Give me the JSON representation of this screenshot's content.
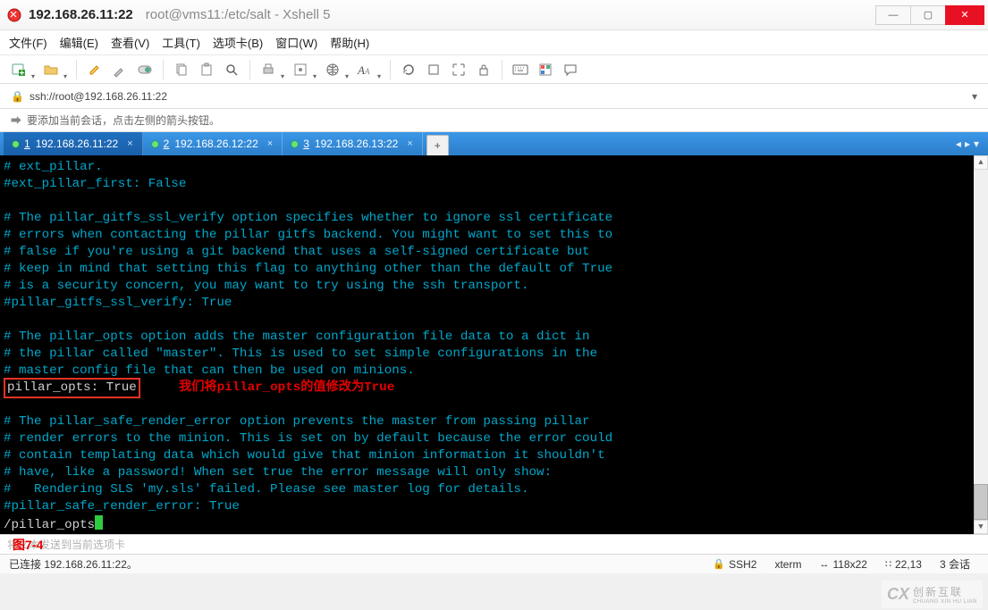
{
  "window": {
    "address_label": "192.168.26.11:22",
    "path_label": "root@vms11:/etc/salt - Xshell 5"
  },
  "menu": {
    "items": [
      "文件(F)",
      "编辑(E)",
      "查看(V)",
      "工具(T)",
      "选项卡(B)",
      "窗口(W)",
      "帮助(H)"
    ]
  },
  "toolbar": {
    "icons": [
      "new-session-icon",
      "open-folder-icon",
      "highlight-icon",
      "eyedropper-icon",
      "toggle-icon",
      "copy-icon",
      "paste-icon",
      "search-icon",
      "print-icon",
      "target-icon",
      "globe-icon",
      "font-icon",
      "refresh-icon",
      "maximize-icon",
      "expand-icon",
      "lock-icon",
      "keyboard-icon",
      "palette-icon",
      "chat-icon"
    ]
  },
  "address": {
    "url": "ssh://root@192.168.26.11:22"
  },
  "hint": {
    "text": "要添加当前会话，点击左侧的箭头按钮。"
  },
  "tabs": {
    "items": [
      {
        "num": "1",
        "label": "192.168.26.11:22",
        "active": true
      },
      {
        "num": "2",
        "label": "192.168.26.12:22",
        "active": false
      },
      {
        "num": "3",
        "label": "192.168.26.13:22",
        "active": false
      }
    ],
    "add": "+"
  },
  "terminal": {
    "lines": [
      "# ext_pillar.",
      "#ext_pillar_first: False",
      "",
      "# The pillar_gitfs_ssl_verify option specifies whether to ignore ssl certificate",
      "# errors when contacting the pillar gitfs backend. You might want to set this to",
      "# false if you're using a git backend that uses a self-signed certificate but",
      "# keep in mind that setting this flag to anything other than the default of True",
      "# is a security concern, you may want to try using the ssh transport.",
      "#pillar_gitfs_ssl_verify: True",
      "",
      "# The pillar_opts option adds the master configuration file data to a dict in",
      "# the pillar called \"master\". This is used to set simple configurations in the",
      "# master config file that can then be used on minions."
    ],
    "highlight": "pillar_opts: True",
    "annotation": "我们将pillar_opts的值修改为True",
    "lines2": [
      "",
      "# The pillar_safe_render_error option prevents the master from passing pillar",
      "# render errors to the minion. This is set on by default because the error could",
      "# contain templating data which would give that minion information it shouldn't",
      "# have, like a password! When set true the error message will only show:",
      "#   Rendering SLS 'my.sls' failed. Please see master log for details.",
      "#pillar_safe_render_error: True"
    ],
    "search": "/pillar_opts"
  },
  "compose": {
    "placeholder": "将文本发送到当前选项卡",
    "figure": "图7-4"
  },
  "status": {
    "conn": "已连接 192.168.26.11:22。",
    "proto": "SSH2",
    "term": "xterm",
    "size": "118x22",
    "pos": "22,13",
    "sess": "3 会话"
  },
  "brand": {
    "big": "CX",
    "cn": "创新互联",
    "py": "CHUANG XIN HU LIAN"
  }
}
